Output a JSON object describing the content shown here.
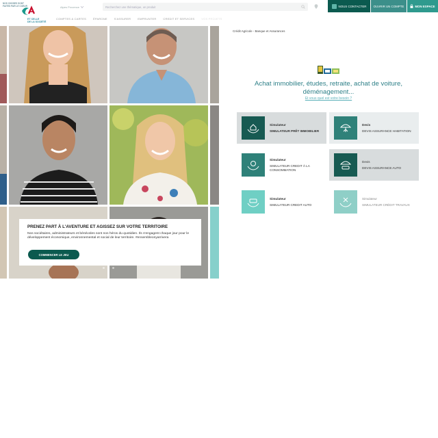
{
  "header": {
    "logo_tagline": "Nos choses sont faites par le coeur",
    "logo_subtitle": "ET CELLE\nDE LA SOCIÉTÉ",
    "region_label": "Alpes Provence",
    "search_placeholder": "Recherchez une thématique, un produit",
    "contact_label": "NOUS CONTACTER",
    "open_account_label": "OUVRIR UN COMPTE",
    "my_space_label": "MON ESPACE",
    "nav": [
      "COMPTES & CARTES",
      "ÉPARGNE",
      "S'ASSURER",
      "EMPRUNTER",
      "CREDIT ET SERVICES",
      "VOS PROJETS"
    ]
  },
  "hero": {
    "promo_title": "PRENEZ PART À L'AVENTURE ET AGISSEZ SUR VOTRE TERRITOIRE",
    "promo_text": "Nos sociétaires, administrateurs et bénévoles sont nos héros du quotidien. Ils s'engagent chaque jour pour le développement économique, environnemental et social de leur territoire. #ensembleonyarrivera",
    "promo_button": "COMMENCER LE JEU",
    "slide_count": 3,
    "active_slide": 2
  },
  "panel": {
    "breadcrumb": "Crédit Agricole - Banque et Assurances",
    "headline": "Achat immobilier, études, retraite, achat de voiture, déménagement...",
    "help_link": "Et vous quel est votre besoin ?",
    "cards": [
      {
        "kind": "Simulateur",
        "name": "SIMULATEUR PRÊT IMMOBILIER",
        "icon": "house-hands-icon"
      },
      {
        "kind": "Devis",
        "name": "DEVIS ASSURANCE HABITATION",
        "icon": "umbrella-house-icon"
      },
      {
        "kind": "Simulateur",
        "name": "SIMULATEUR CREDIT À LA CONSOMMATION",
        "icon": "coins-hands-icon"
      },
      {
        "kind": "Devis",
        "name": "DEVIS ASSURANCE AUTO",
        "icon": "umbrella-car-icon"
      },
      {
        "kind": "Simulateur",
        "name": "SIMULATEUR CREDIT AUTO",
        "icon": "car-hands-icon"
      },
      {
        "kind": "Simulateur",
        "name": "SIMULATEUR CRÉDIT TRAVAUX",
        "icon": "tools-hands-icon"
      }
    ]
  },
  "colors": {
    "brand_dark": "#0b5a4f",
    "brand_teal": "#2f9a8e",
    "headline": "#2d7f87"
  }
}
